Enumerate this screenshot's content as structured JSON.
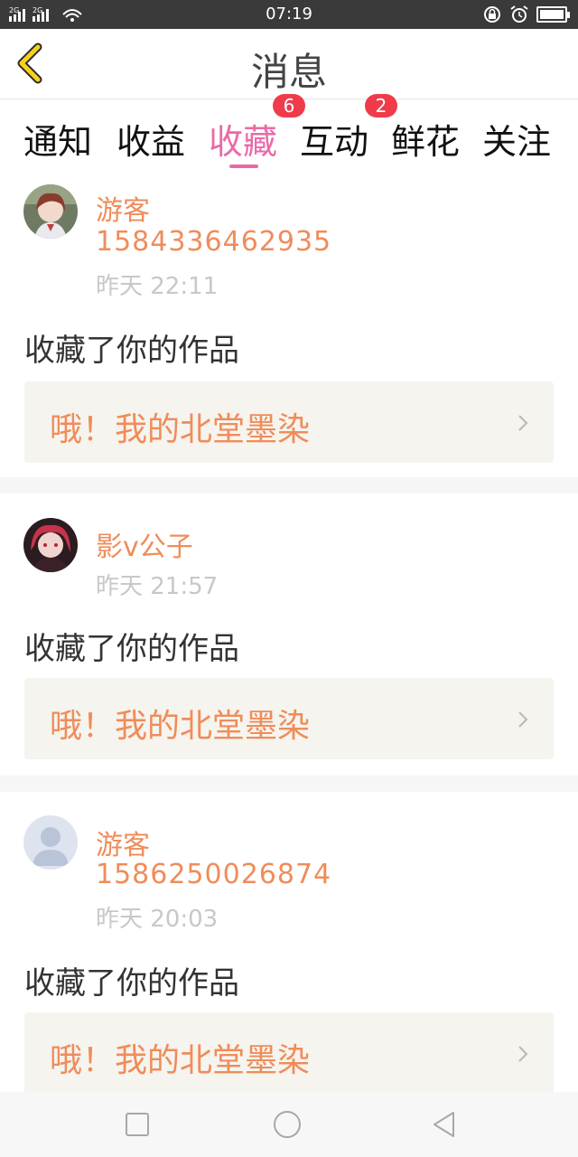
{
  "status_bar": {
    "signal": "2G 2G",
    "time": "07:19",
    "battery_level": 1.0
  },
  "header": {
    "title": "消息",
    "back_icon": "chevron-left-icon",
    "accent_color": "#f5d21c"
  },
  "tabs": [
    {
      "label": "通知",
      "badge": ""
    },
    {
      "label": "收益",
      "badge": ""
    },
    {
      "label": "收藏",
      "badge": "6",
      "active": true
    },
    {
      "label": "互动",
      "badge": "2"
    },
    {
      "label": "鲜花",
      "badge": ""
    },
    {
      "label": "关注",
      "badge": ""
    }
  ],
  "colors": {
    "active_tab": "#ea6aa7",
    "name": "#f08c5a",
    "badge": "#ef3b4a"
  },
  "messages": [
    {
      "name": "游客",
      "phone": "1584336462935",
      "time": "昨天 22:11",
      "action": "收藏了你的作品",
      "work": "哦！我的北堂墨染"
    },
    {
      "name": "影v公子",
      "phone": "",
      "time": "昨天 21:57",
      "action": "收藏了你的作品",
      "work": "哦！我的北堂墨染"
    },
    {
      "name": "游客",
      "phone": "1586250026874",
      "time": "昨天 20:03",
      "action": "收藏了你的作品",
      "work": "哦！我的北堂墨染"
    }
  ],
  "nav": {
    "recents_icon": "square-icon",
    "home_icon": "circle-icon",
    "back_icon": "triangle-back-icon"
  }
}
